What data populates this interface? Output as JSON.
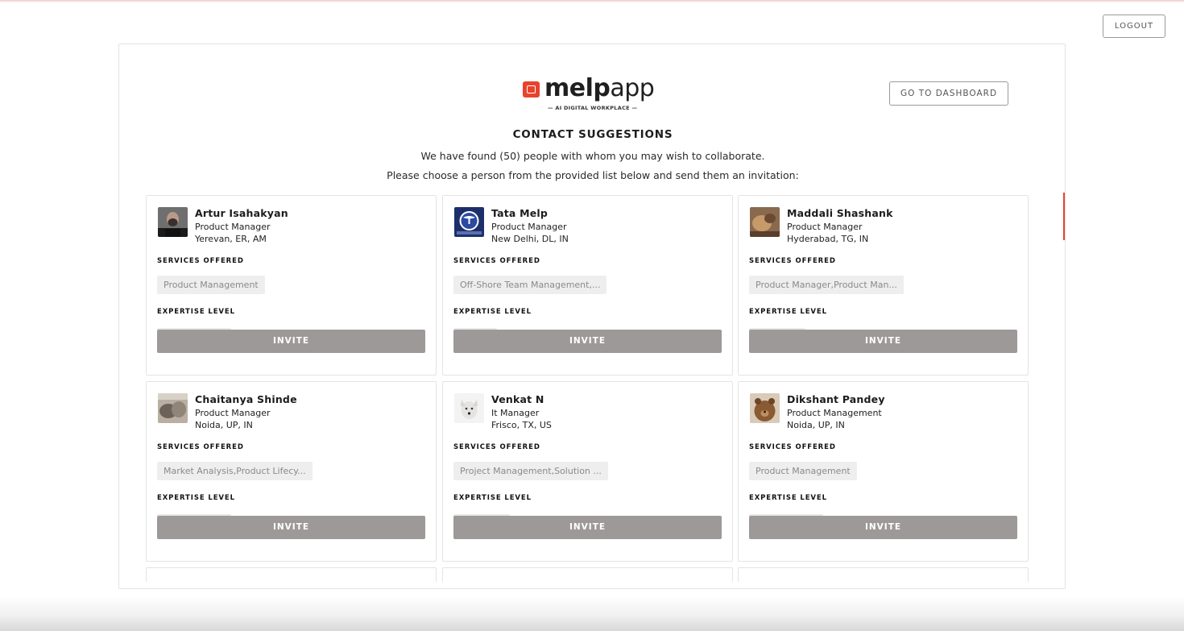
{
  "header": {
    "logout_label": "LOGOUT",
    "goto_dashboard_label": "GO TO DASHBOARD"
  },
  "logo": {
    "word_bold": "melp",
    "word_light": "app",
    "tagline": "— AI DIGITAL WORKPLACE —",
    "brand_color": "#e8432e"
  },
  "page": {
    "title": "CONTACT SUGGESTIONS",
    "found_line": "We have found (50) people with whom you may wish to collaborate.",
    "choose_line": "Please choose a person from the provided list below and send them an invitation:"
  },
  "labels": {
    "services_offered": "SERVICES OFFERED",
    "expertise_level": "EXPERTISE LEVEL",
    "invite": "INVITE"
  },
  "people": [
    {
      "name": "Artur Isahakyan",
      "role": "Product Manager",
      "location": "Yerevan, ER, AM",
      "services": "Product Management",
      "avatar_icon": "person-photo-icon"
    },
    {
      "name": "Tata Melp",
      "role": "Product Manager",
      "location": "New Delhi, DL, IN",
      "services": "Off-Shore Team Management,...",
      "avatar_icon": "tata-logo-icon"
    },
    {
      "name": "Maddali Shashank",
      "role": "Product Manager",
      "location": "Hyderabad, TG, IN",
      "services": "Product Manager,Product Man...",
      "avatar_icon": "animal-photo-icon"
    },
    {
      "name": "Chaitanya Shinde",
      "role": "Product Manager",
      "location": "Noida, UP, IN",
      "services": "Market Analysis,Product Lifecy...",
      "avatar_icon": "animal-photo-icon"
    },
    {
      "name": "Venkat N",
      "role": "It Manager",
      "location": "Frisco, TX, US",
      "services": "Project Management,Solution ...",
      "avatar_icon": "wolf-photo-icon"
    },
    {
      "name": "Dikshant Pandey",
      "role": "Product Management",
      "location": "Noida, UP, IN",
      "services": "Product Management",
      "avatar_icon": "bear-photo-icon"
    }
  ]
}
